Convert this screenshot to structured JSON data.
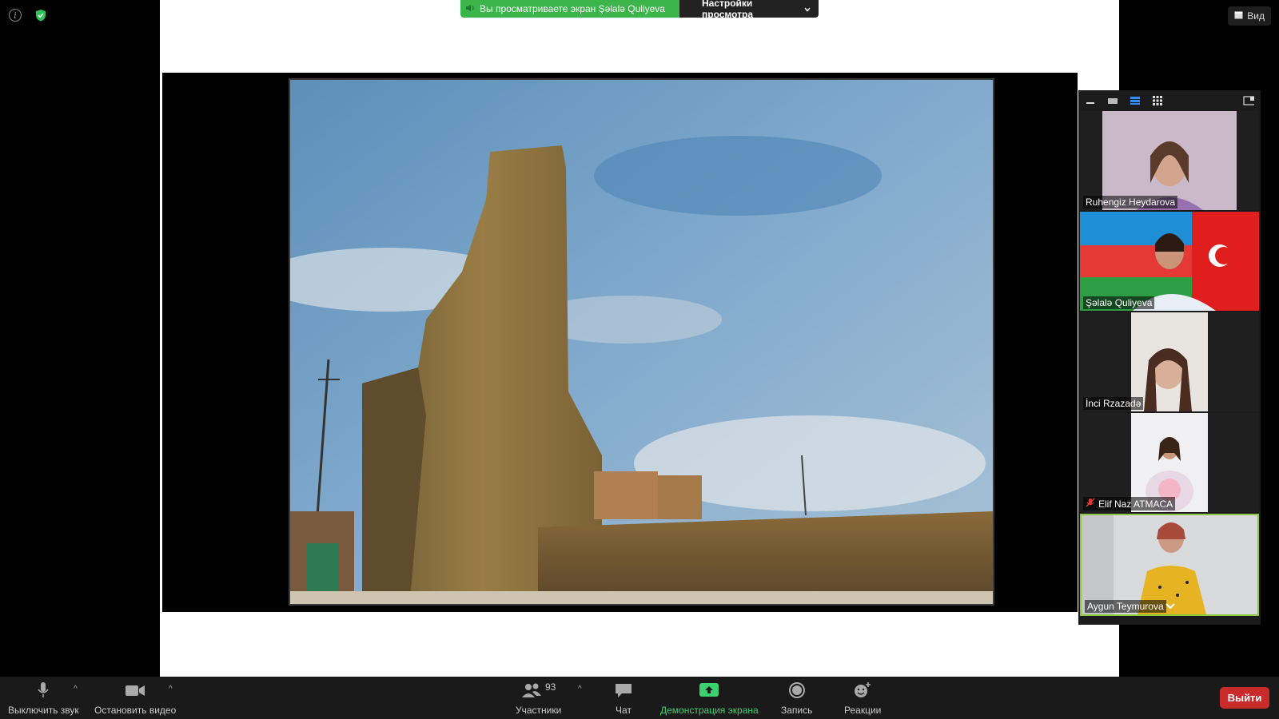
{
  "banner": {
    "status_text": "Вы просматриваете экран Şəlalə Quliyeva",
    "view_settings_label": "Настройки просмотра"
  },
  "top_right": {
    "view_label": "Вид"
  },
  "gallery": {
    "participants": [
      {
        "name": "Ruhengiz Heydarova",
        "muted": false,
        "active": false
      },
      {
        "name": "Şəlalə Quliyeva",
        "muted": false,
        "active": false
      },
      {
        "name": "İnci Rzazadə",
        "muted": false,
        "active": false
      },
      {
        "name": "Elif Naz ATMACA",
        "muted": true,
        "active": false
      },
      {
        "name": "Aygun Teymurova",
        "muted": false,
        "active": true
      }
    ]
  },
  "toolbar": {
    "mute_label": "Выключить звук",
    "video_label": "Остановить видео",
    "participants_label": "Участники",
    "participants_count": "93",
    "chat_label": "Чат",
    "share_label": "Демонстрация экрана",
    "record_label": "Запись",
    "reactions_label": "Реакции",
    "leave_label": "Выйти"
  },
  "colors": {
    "share_green": "#3bb54a",
    "leave_red": "#c92a2a",
    "active_speaker_border": "#8ec63f"
  }
}
